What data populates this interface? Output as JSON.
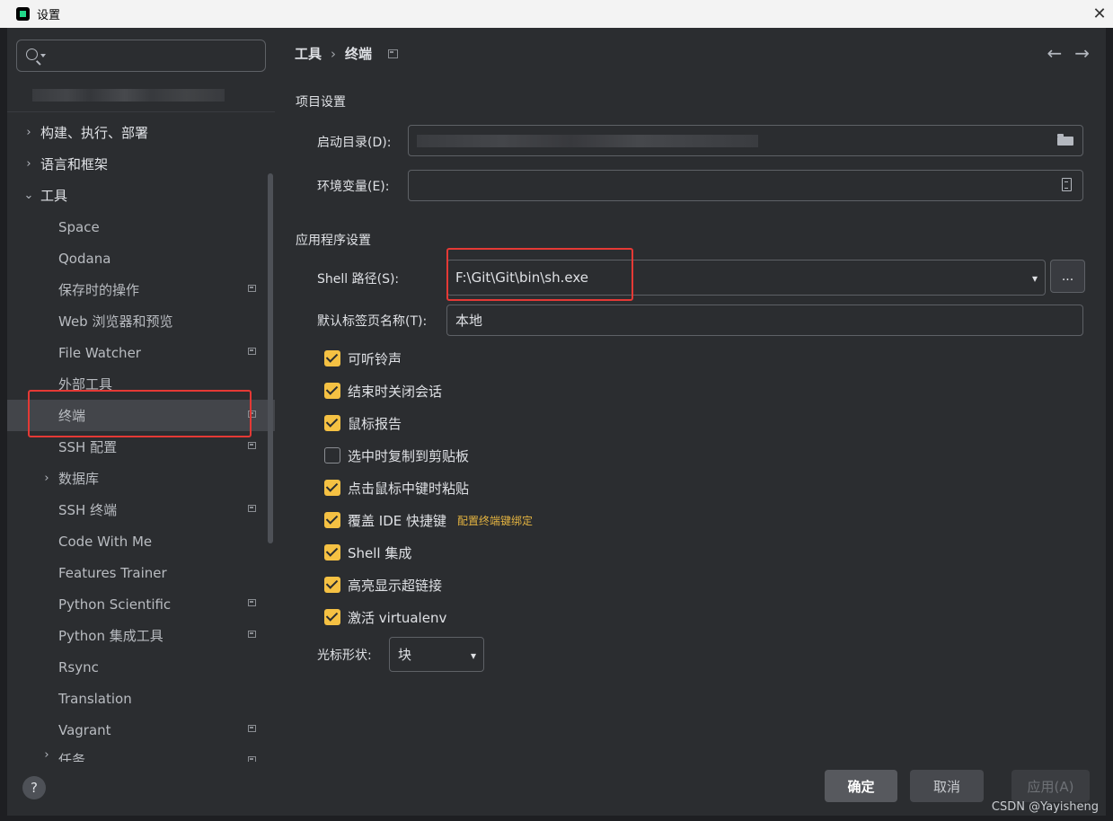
{
  "window": {
    "title": "设置",
    "close_glyph": "✕"
  },
  "search": {
    "placeholder": ""
  },
  "sidebar": {
    "items": [
      {
        "label": "构建、执行、部署",
        "chevron": "›",
        "level": 0
      },
      {
        "label": "语言和框架",
        "chevron": "›",
        "level": 0
      },
      {
        "label": "工具",
        "chevron": "⌄",
        "level": 0,
        "expanded": true
      },
      {
        "label": "Space",
        "level": 1
      },
      {
        "label": "Qodana",
        "level": 1
      },
      {
        "label": "保存时的操作",
        "level": 1,
        "marked": true
      },
      {
        "label": "Web 浏览器和预览",
        "level": 1
      },
      {
        "label": "File Watcher",
        "level": 1,
        "marked": true
      },
      {
        "label": "外部工具",
        "level": 1
      },
      {
        "label": "终端",
        "level": 1,
        "marked": true,
        "selected": true
      },
      {
        "label": "SSH 配置",
        "level": 1,
        "marked": true
      },
      {
        "label": "数据库",
        "chevron": "›",
        "level": 1
      },
      {
        "label": "SSH 终端",
        "level": 1,
        "marked": true
      },
      {
        "label": "Code With Me",
        "level": 1
      },
      {
        "label": "Features Trainer",
        "level": 1
      },
      {
        "label": "Python Scientific",
        "level": 1,
        "marked": true
      },
      {
        "label": "Python 集成工具",
        "level": 1,
        "marked": true
      },
      {
        "label": "Rsync",
        "level": 1
      },
      {
        "label": "Translation",
        "level": 1
      },
      {
        "label": "Vagrant",
        "level": 1,
        "marked": true
      },
      {
        "label": "任务",
        "chevron": "›",
        "level": 1,
        "marked": true
      }
    ],
    "help_glyph": "?"
  },
  "breadcrumb": {
    "parent": "工具",
    "separator": "›",
    "current": "终端"
  },
  "nav": {
    "back": "←",
    "forward": "→"
  },
  "project_settings": {
    "title": "项目设置",
    "start_dir_label": "启动目录(D):",
    "env_vars_label": "环境变量(E):",
    "env_vars_value": ""
  },
  "app_settings": {
    "title": "应用程序设置",
    "shell_path_label": "Shell 路径(S):",
    "shell_path_value": "F:\\Git\\Git\\bin\\sh.exe",
    "dots_label": "...",
    "tab_name_label": "默认标签页名称(T):",
    "tab_name_value": "本地",
    "checkboxes": [
      {
        "label": "可听铃声",
        "checked": true
      },
      {
        "label": "结束时关闭会话",
        "checked": true
      },
      {
        "label": "鼠标报告",
        "checked": true
      },
      {
        "label": "选中时复制到剪贴板",
        "checked": false
      },
      {
        "label": "点击鼠标中键时粘贴",
        "checked": true
      },
      {
        "label": "覆盖 IDE 快捷键",
        "checked": true,
        "link": "配置终端键绑定"
      },
      {
        "label": "Shell 集成",
        "checked": true
      },
      {
        "label": "高亮显示超链接",
        "checked": true
      },
      {
        "label": "激活 virtualenv",
        "checked": true
      }
    ],
    "cursor_shape_label": "光标形状:",
    "cursor_shape_value": "块"
  },
  "buttons": {
    "ok": "确定",
    "cancel": "取消",
    "apply": "应用(A)"
  },
  "watermark": "CSDN @Yayisheng",
  "colors": {
    "accent_checkbox": "#f5c143",
    "link": "#e3b341",
    "highlight_box": "#e53935",
    "background": "#2b2d30"
  }
}
